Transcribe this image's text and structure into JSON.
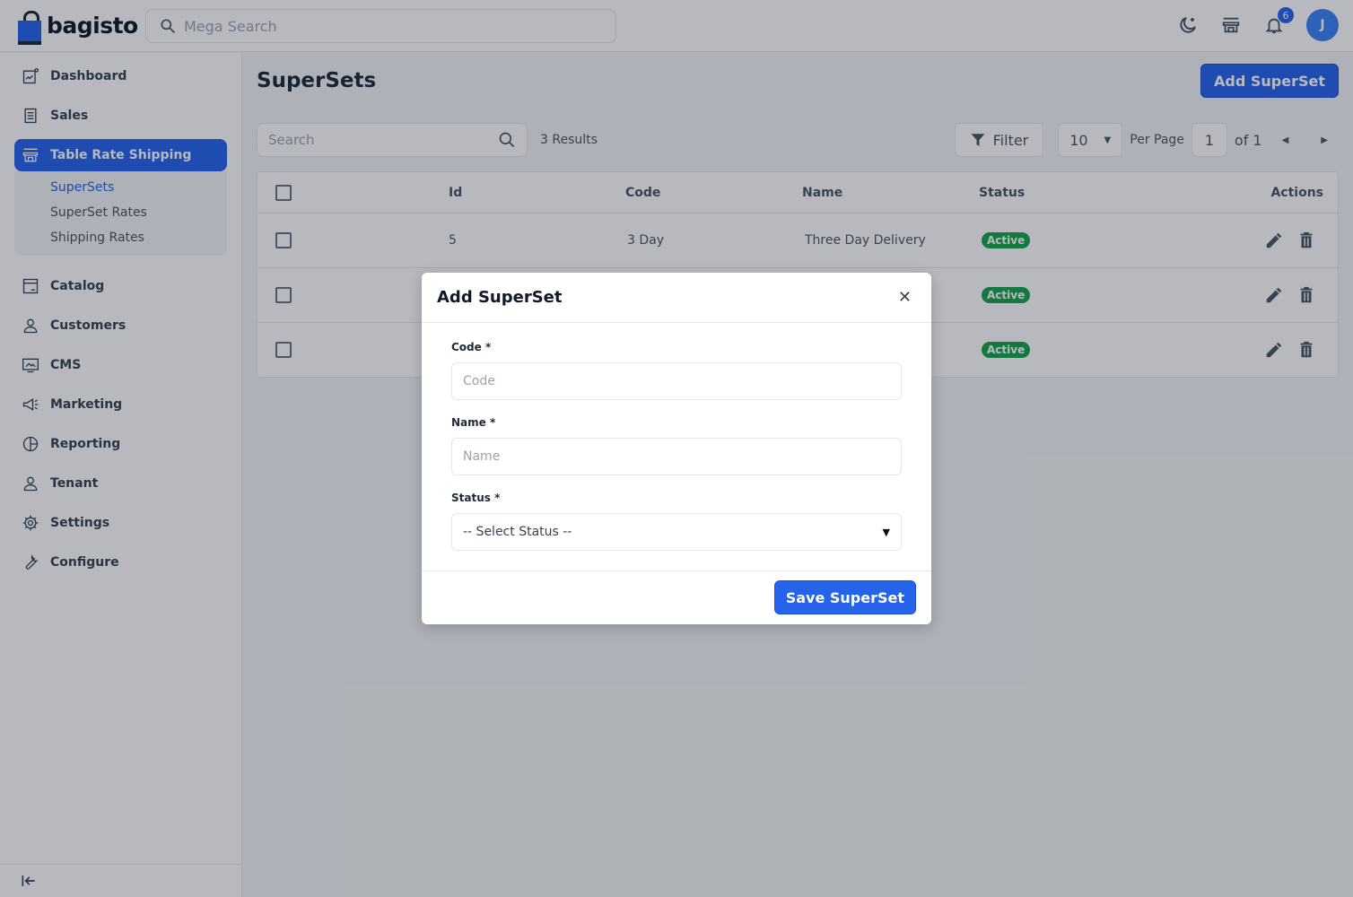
{
  "header": {
    "logo_text": "bagisto",
    "search_placeholder": "Mega Search",
    "notification_count": "6",
    "avatar_initial": "J"
  },
  "sidebar": {
    "items": [
      {
        "label": "Dashboard",
        "icon": "dashboard-icon"
      },
      {
        "label": "Sales",
        "icon": "receipt-icon"
      },
      {
        "label": "Table Rate Shipping",
        "icon": "store-icon",
        "active": true,
        "children": [
          {
            "label": "SuperSets",
            "current": true
          },
          {
            "label": "SuperSet Rates"
          },
          {
            "label": "Shipping Rates"
          }
        ]
      },
      {
        "label": "Catalog",
        "icon": "catalog-icon"
      },
      {
        "label": "Customers",
        "icon": "user-icon"
      },
      {
        "label": "CMS",
        "icon": "monitor-icon"
      },
      {
        "label": "Marketing",
        "icon": "megaphone-icon"
      },
      {
        "label": "Reporting",
        "icon": "chart-pie-icon"
      },
      {
        "label": "Tenant",
        "icon": "user-icon"
      },
      {
        "label": "Settings",
        "icon": "gear-icon"
      },
      {
        "label": "Configure",
        "icon": "wrench-icon"
      }
    ]
  },
  "main": {
    "title": "SuperSets",
    "add_button": "Add SuperSet",
    "search_placeholder": "Search",
    "results": "3 Results",
    "filter": "Filter",
    "per_page_value": "10",
    "per_page_label": "Per Page",
    "page": "1",
    "of_pages": "of 1",
    "columns": [
      "Id",
      "Code",
      "Name",
      "Status",
      "Actions"
    ],
    "rows": [
      {
        "id": "5",
        "code": "3 Day",
        "name": "Three Day Delivery",
        "status": "Active"
      },
      {
        "id": "",
        "code": "",
        "name": "",
        "status": "Active"
      },
      {
        "id": "",
        "code": "",
        "name": "",
        "status": "Active"
      }
    ]
  },
  "modal": {
    "title": "Add SuperSet",
    "code_label": "Code *",
    "code_placeholder": "Code",
    "name_label": "Name *",
    "name_placeholder": "Name",
    "status_label": "Status *",
    "status_value": "-- Select Status --",
    "save_button": "Save SuperSet"
  },
  "colors": {
    "primary": "#2563eb",
    "active_status": "#16a34a"
  }
}
